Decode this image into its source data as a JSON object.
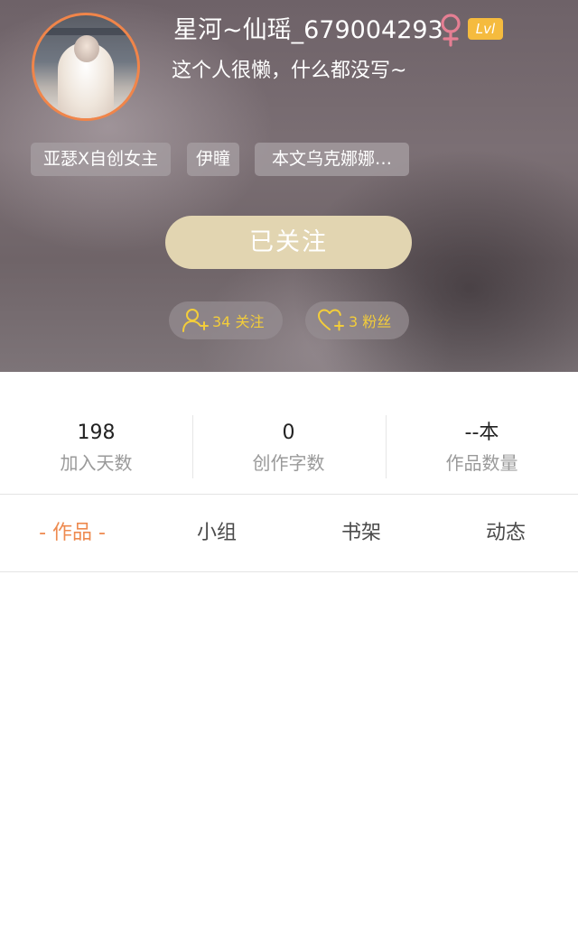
{
  "profile": {
    "username": "星河~仙瑶_679004293",
    "gender": "female",
    "level_badge": "Lvl",
    "bio": "这个人很懒，什么都没写~"
  },
  "tags": [
    "亚瑟X自创女主",
    "伊瞳",
    "本文乌克娜娜…"
  ],
  "follow_button_label": "已关注",
  "chips": {
    "following": "34 关注",
    "fans": "3 粉丝"
  },
  "stats": [
    {
      "value": "198",
      "label": "加入天数"
    },
    {
      "value": "0",
      "label": "创作字数"
    },
    {
      "value": "--本",
      "label": "作品数量"
    }
  ],
  "tabs": [
    {
      "label": "- 作品 -",
      "active": true
    },
    {
      "label": "小组",
      "active": false
    },
    {
      "label": "书架",
      "active": false
    },
    {
      "label": "动态",
      "active": false
    }
  ],
  "colors": {
    "accent": "#ee8a4f",
    "avatar_border": "#f0854a",
    "follow_button": "#e2d5b1",
    "level_badge": "#f5bb3e",
    "gender_icon": "#e57f93",
    "chip_text": "#f3cd3a"
  },
  "icons": [
    "female-gender-icon",
    "add-user-icon",
    "heart-plus-icon"
  ]
}
